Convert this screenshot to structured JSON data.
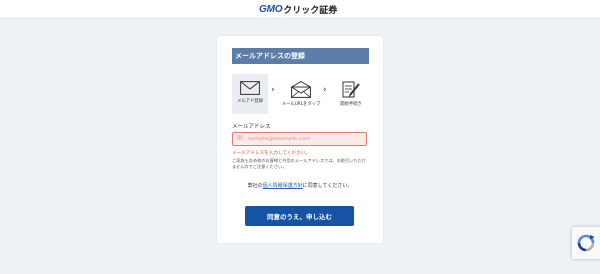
{
  "header": {
    "logo_brand": "GMO",
    "logo_name": "クリック証券"
  },
  "form": {
    "title": "メールアドレスの登録",
    "steps": [
      {
        "label": "メルアド登録",
        "icon": "envelope-icon",
        "active": true
      },
      {
        "label": "メールURLをタップ",
        "icon": "open-envelope-icon",
        "active": false
      },
      {
        "label": "開始手続き",
        "icon": "form-pen-icon",
        "active": false
      }
    ],
    "step_separator": "›",
    "email": {
      "label": "メールアドレス",
      "placeholder": "例：sample@example.com",
      "value": "",
      "error": "メールアドレスを入力してください。"
    },
    "note": "ご家族も含め他のお客様と共用のメールアドレスでは、お取引いただけませんのでご注意ください。",
    "agree": {
      "prefix": "弊社の",
      "link": "個人情報保護方針",
      "suffix": "に同意してください。"
    },
    "submit_label": "同意のうえ、申し込む"
  },
  "colors": {
    "title_bg": "#5b7da8",
    "button_bg": "#1653a4",
    "error": "#e0403d",
    "input_error_bg": "#fde9e8",
    "link": "#2b62b7"
  }
}
